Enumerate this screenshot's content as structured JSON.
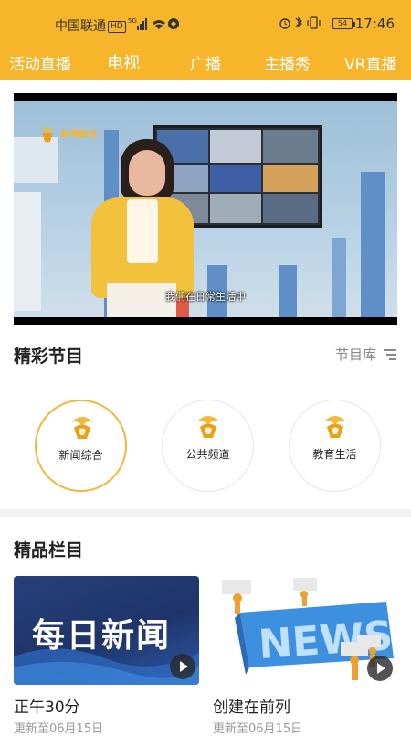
{
  "status_bar": {
    "carrier": "中国联通",
    "hd_badge": "HD",
    "network": "5G",
    "battery": "54",
    "time": "17:46"
  },
  "nav": {
    "tabs": [
      "活动直播",
      "电视",
      "广播",
      "主播秀",
      "VR直播"
    ]
  },
  "player": {
    "channel_watermark": "新闻综合",
    "subtitle": "我们在日常生活中"
  },
  "featured": {
    "title": "精彩节目",
    "library_label": "节目库",
    "channels": [
      {
        "label": "新闻综合",
        "active": true
      },
      {
        "label": "公共频道",
        "active": false
      },
      {
        "label": "教育生活",
        "active": false
      }
    ]
  },
  "columns": {
    "title": "精品栏目",
    "items": [
      {
        "title": "正午30分",
        "subtitle": "更新至06月15日",
        "banner_text": "每日新闻"
      },
      {
        "title": "创建在前列",
        "subtitle": "更新至06月15日",
        "banner_text": "NEWS"
      }
    ]
  },
  "colors": {
    "brand": "#f7b52c",
    "active_ring": "#f2b83a"
  }
}
